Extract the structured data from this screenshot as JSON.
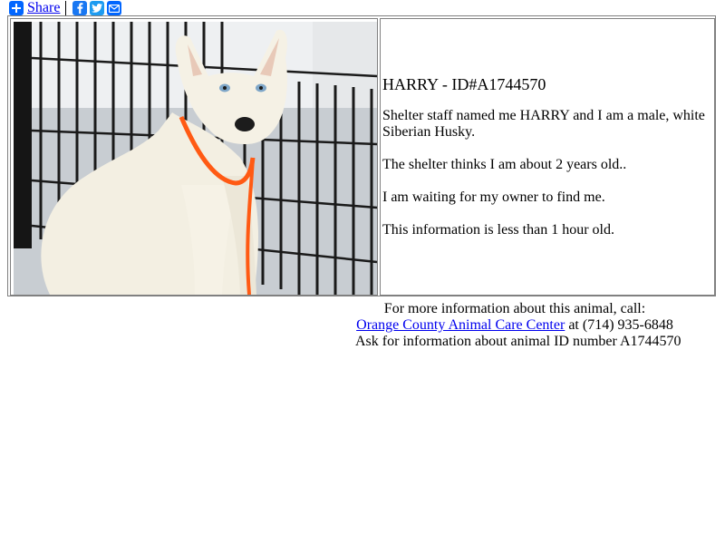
{
  "share_bar": {
    "share_label": "Share",
    "icons": [
      "plus-icon",
      "facebook-icon",
      "twitter-icon",
      "email-icon"
    ]
  },
  "pet": {
    "title": "HARRY - ID#A1744570",
    "description": "Shelter staff named me HARRY and I am a male, white Siberian Husky.",
    "age": "The shelter thinks I am about 2 years old..",
    "status": "I am waiting for my owner to find me.",
    "freshness": "This information is less than 1 hour old."
  },
  "footer": {
    "intro": "For more information about this animal, call:",
    "shelter_name": "Orange County Animal Care Center",
    "phone_text": " at (714) 935-6848",
    "ask_text": "Ask for information about animal ID number A1744570"
  },
  "colors": {
    "link": "#0000ee",
    "share_blue": "#0166ff",
    "facebook": "#1877f2",
    "twitter": "#1d9bf0",
    "leash_orange": "#ff5a14"
  }
}
